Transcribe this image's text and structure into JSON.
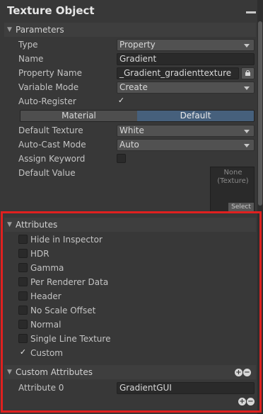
{
  "window": {
    "title": "Texture Object"
  },
  "parameters": {
    "header": "Parameters",
    "type": {
      "label": "Type",
      "value": "Property"
    },
    "name": {
      "label": "Name",
      "value": "Gradient"
    },
    "property_name": {
      "label": "Property Name",
      "value": "_Gradient_gradienttexture"
    },
    "variable_mode": {
      "label": "Variable Mode",
      "value": "Create"
    },
    "auto_register": {
      "label": "Auto-Register",
      "checked": true,
      "mark": "✓"
    },
    "toggle": {
      "options": [
        "Material",
        "Default"
      ],
      "selected": "Default"
    },
    "default_texture": {
      "label": "Default Texture",
      "value": "White"
    },
    "auto_cast_mode": {
      "label": "Auto-Cast Mode",
      "value": "Auto"
    },
    "assign_keyword": {
      "label": "Assign Keyword",
      "checked": false
    },
    "default_value": {
      "label": "Default Value",
      "none_line1": "None",
      "none_line2": "(Texture)",
      "select_label": "Select"
    }
  },
  "attributes": {
    "header": "Attributes",
    "items": [
      {
        "label": "Hide in Inspector",
        "checked": false
      },
      {
        "label": "HDR",
        "checked": false
      },
      {
        "label": "Gamma",
        "checked": false
      },
      {
        "label": "Per Renderer Data",
        "checked": false
      },
      {
        "label": "Header",
        "checked": false
      },
      {
        "label": "No Scale Offset",
        "checked": false
      },
      {
        "label": "Normal",
        "checked": false
      },
      {
        "label": "Single Line Texture",
        "checked": false
      },
      {
        "label": "Custom",
        "checked": true
      }
    ],
    "check_mark": "✓"
  },
  "custom_attributes": {
    "header": "Custom Attributes",
    "rows": [
      {
        "label": "Attribute 0",
        "value": "GradientGUI"
      }
    ],
    "plus": "+",
    "minus": "−"
  },
  "colors": {
    "highlight": "#e0201f",
    "toggle_active": "#46607c",
    "background": "#383838"
  }
}
